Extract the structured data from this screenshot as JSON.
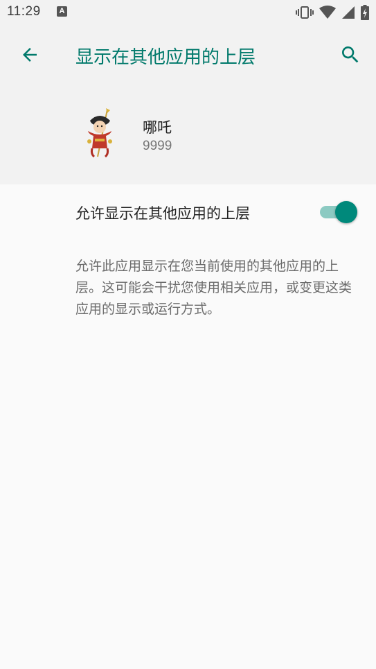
{
  "status_bar": {
    "time": "11:29",
    "notification_badge": "A",
    "icons": [
      "vibrate-icon",
      "wifi-icon",
      "signal-icon",
      "battery-charging-icon"
    ]
  },
  "app_bar": {
    "title": "显示在其他应用的上层",
    "back_icon": "arrow-back-icon",
    "search_icon": "search-icon"
  },
  "app_info": {
    "name": "哪吒",
    "version": "9999"
  },
  "setting": {
    "label": "允许显示在其他应用的上层",
    "enabled": true
  },
  "description": "允许此应用显示在您当前使用的其他应用的上层。这可能会干扰您使用相关应用，或变更这类应用的显示或运行方式。",
  "colors": {
    "accent": "#00796b",
    "toggle_thumb": "#00897b",
    "toggle_track": "#8ccac2",
    "header_bg": "#f2f2f2",
    "body_bg": "#fafafa"
  }
}
